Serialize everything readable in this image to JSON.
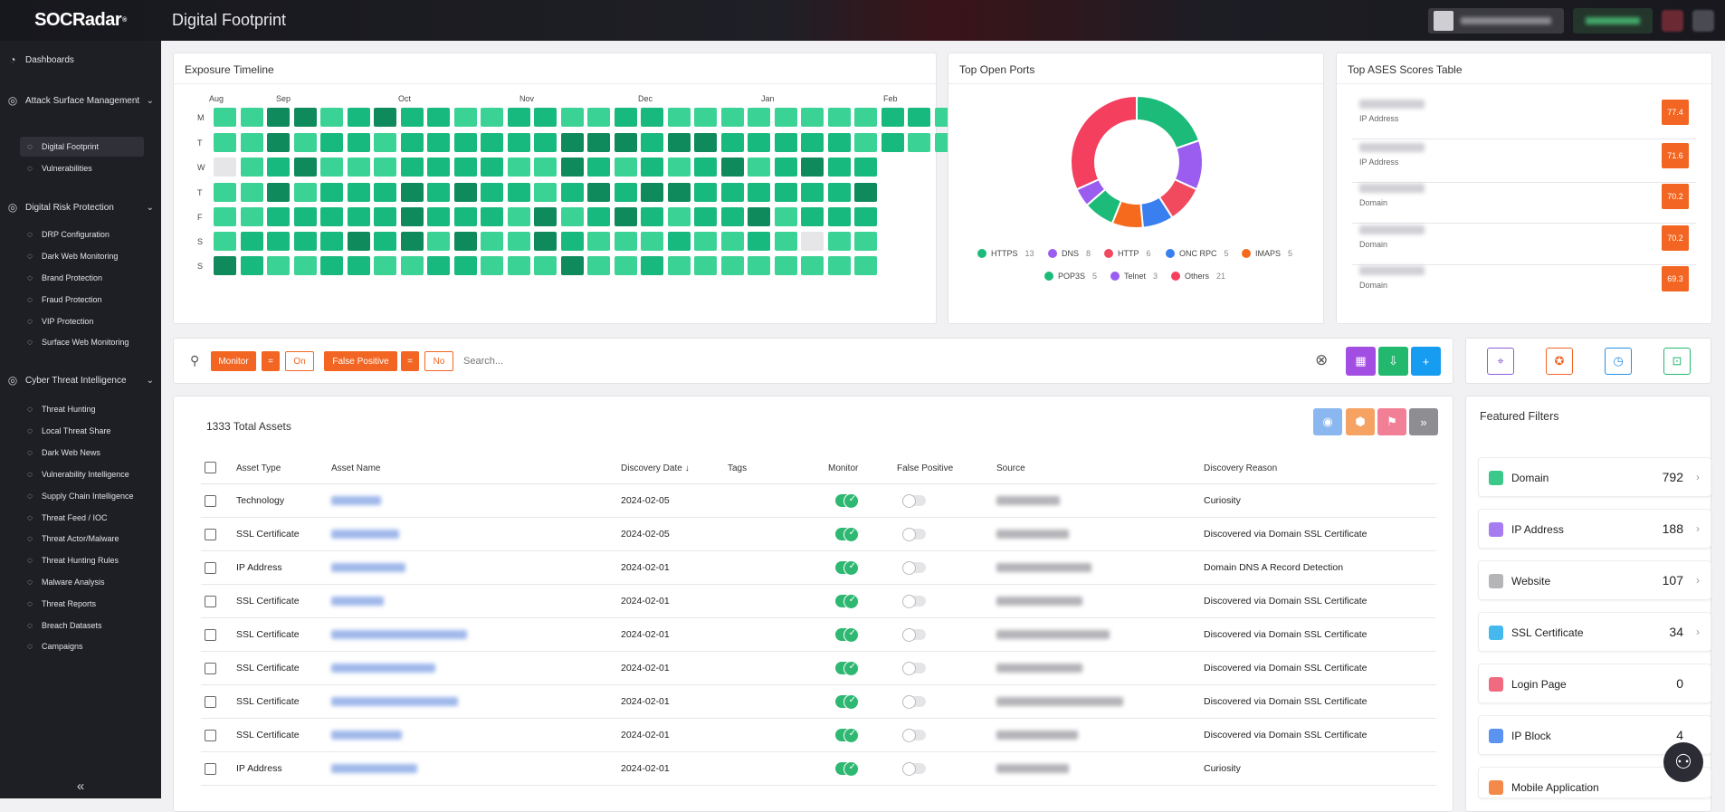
{
  "app": {
    "logo": "SOCRadar",
    "logo_mark": "®",
    "title": "Digital Footprint"
  },
  "sidebar": {
    "dashboards": "Dashboards",
    "groups": [
      {
        "label": "Attack Surface Management",
        "items": [
          "Digital Footprint",
          "Vulnerabilities"
        ]
      },
      {
        "label": "Digital Risk Protection",
        "items": [
          "DRP Configuration",
          "Dark Web Monitoring",
          "Brand Protection",
          "Fraud Protection",
          "VIP Protection",
          "Surface Web Monitoring"
        ]
      },
      {
        "label": "Cyber Threat Intelligence",
        "items": [
          "Threat Hunting",
          "Local Threat Share",
          "Dark Web News",
          "Vulnerability Intelligence",
          "Supply Chain Intelligence",
          "Threat Feed / IOC",
          "Threat Actor/Malware",
          "Threat Hunting Rules",
          "Malware Analysis",
          "Threat Reports",
          "Breach Datasets",
          "Campaigns"
        ]
      }
    ],
    "collapse": "«"
  },
  "exposure": {
    "title": "Exposure Timeline",
    "months": [
      "Aug",
      "Sep",
      "Oct",
      "Nov",
      "Dec",
      "Jan",
      "Feb"
    ],
    "days": [
      "M",
      "T",
      "W",
      "T",
      "F",
      "S",
      "S"
    ],
    "grid": [
      "1133123221122112211111111221",
      "1131221222222333233222221211",
      "0123111222211321212312322",
      "1131222323221232332222223",
      "1122222322213123212231222",
      "1222232313113211121121011",
      "3211221122111311211111111"
    ],
    "levels": [
      "#e6e6e8",
      "#3ad395",
      "#18b97e",
      "#0f8a5d",
      "#0b5e3e"
    ]
  },
  "ports": {
    "title": "Top Open Ports",
    "chart_data": {
      "type": "pie",
      "values": [
        13,
        8,
        6,
        5,
        5,
        5,
        3,
        21
      ],
      "categories": [
        "HTTPS",
        "DNS",
        "HTTP",
        "ONC RPC",
        "IMAPS",
        "POP3S",
        "Telnet",
        "Others"
      ],
      "colors": [
        "#1dbb7a",
        "#9b5cf0",
        "#f14a5f",
        "#3a7ff0",
        "#f56a1c",
        "#1dbb7a",
        "#9b5cf0",
        "#f43f5e"
      ]
    },
    "legend": [
      {
        "name": "HTTPS",
        "count": "13",
        "color": "#1dbb7a"
      },
      {
        "name": "DNS",
        "count": "8",
        "color": "#9b5cf0"
      },
      {
        "name": "HTTP",
        "count": "6",
        "color": "#f14a5f"
      },
      {
        "name": "ONC RPC",
        "count": "5",
        "color": "#3a7ff0"
      },
      {
        "name": "IMAPS",
        "count": "5",
        "color": "#f56a1c"
      },
      {
        "name": "POP3S",
        "count": "5",
        "color": "#1dbb7a"
      },
      {
        "name": "Telnet",
        "count": "3",
        "color": "#9b5cf0"
      },
      {
        "name": "Others",
        "count": "21",
        "color": "#f43f5e"
      }
    ]
  },
  "ases": {
    "title": "Top ASES Scores Table",
    "rows": [
      {
        "type": "IP Address",
        "score": "77.4"
      },
      {
        "type": "IP Address",
        "score": "71.6"
      },
      {
        "type": "Domain",
        "score": "70.2"
      },
      {
        "type": "Domain",
        "score": "70.2"
      },
      {
        "type": "Domain",
        "score": "69.3"
      }
    ]
  },
  "filterbar": {
    "chip1": "Monitor",
    "eq1": "=",
    "val1": "On",
    "chip2": "False Positive",
    "eq2": "=",
    "val2": "No",
    "placeholder": "Search...",
    "clear": "⊗",
    "calendar": "▦",
    "download": "⇩",
    "add": "+"
  },
  "quick_actions": [
    "⌖",
    "✪",
    "◷",
    "⊡"
  ],
  "assets": {
    "total": "1333 Total Assets",
    "actions": [
      "◉",
      "⬢",
      "⚑",
      "»"
    ],
    "columns": [
      "Asset Type",
      "Asset Name",
      "Discovery Date",
      "Tags",
      "Monitor",
      "False Positive",
      "Source",
      "Discovery Reason"
    ],
    "sort_arrow": "↓",
    "rows": [
      {
        "type": "Technology",
        "date": "2024-02-05",
        "reason": "Curiosity",
        "nw": 55,
        "sw": 70
      },
      {
        "type": "SSL Certificate",
        "date": "2024-02-05",
        "reason": "Discovered via Domain SSL Certificate",
        "nw": 75,
        "sw": 80
      },
      {
        "type": "IP Address",
        "date": "2024-02-01",
        "reason": "Domain DNS A Record Detection",
        "nw": 82,
        "sw": 105
      },
      {
        "type": "SSL Certificate",
        "date": "2024-02-01",
        "reason": "Discovered via Domain SSL Certificate",
        "nw": 58,
        "sw": 95
      },
      {
        "type": "SSL Certificate",
        "date": "2024-02-01",
        "reason": "Discovered via Domain SSL Certificate",
        "nw": 150,
        "sw": 125
      },
      {
        "type": "SSL Certificate",
        "date": "2024-02-01",
        "reason": "Discovered via Domain SSL Certificate",
        "nw": 115,
        "sw": 95
      },
      {
        "type": "SSL Certificate",
        "date": "2024-02-01",
        "reason": "Discovered via Domain SSL Certificate",
        "nw": 140,
        "sw": 140
      },
      {
        "type": "SSL Certificate",
        "date": "2024-02-01",
        "reason": "Discovered via Domain SSL Certificate",
        "nw": 78,
        "sw": 90
      },
      {
        "type": "IP Address",
        "date": "2024-02-01",
        "reason": "Curiosity",
        "nw": 95,
        "sw": 80
      }
    ]
  },
  "featured": {
    "title": "Featured Filters",
    "items": [
      {
        "label": "Domain",
        "count": "792",
        "color": "#3ac98a",
        "arrow": "›"
      },
      {
        "label": "IP Address",
        "count": "188",
        "color": "#a77cf0",
        "arrow": "›"
      },
      {
        "label": "Website",
        "count": "107",
        "color": "#b5b5b8",
        "arrow": "›"
      },
      {
        "label": "SSL Certificate",
        "count": "34",
        "color": "#45b8ee",
        "arrow": "›"
      },
      {
        "label": "Login Page",
        "count": "0",
        "color": "#f06b80",
        "arrow": ""
      },
      {
        "label": "IP Block",
        "count": "4",
        "color": "#5a93f0",
        "arrow": ""
      },
      {
        "label": "Mobile Application",
        "count": "",
        "color": "#f38a4a",
        "arrow": ""
      }
    ]
  },
  "help": "⚇"
}
